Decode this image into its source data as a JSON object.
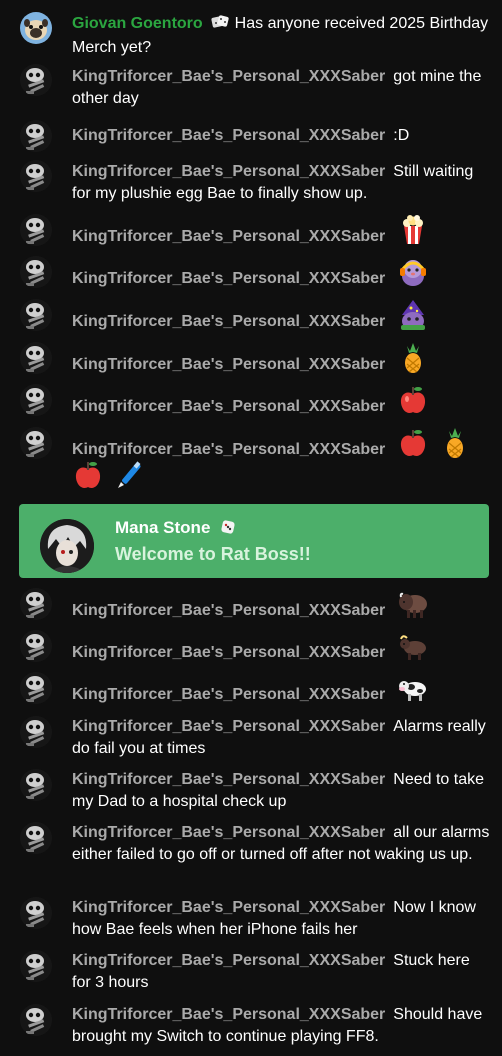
{
  "messages": [
    {
      "author": "Giovan Goentoro",
      "text": "Has anyone received 2025 Birthday Merch yet?",
      "author_color": "#2ba640",
      "avatar": "pug-avatar"
    },
    {
      "author": "KingTriforcer_Bae's_Personal_XXXSaber",
      "text": "got mine the other day"
    },
    {
      "author": "KingTriforcer_Bae's_Personal_XXXSaber",
      "text": ":D"
    },
    {
      "author": "KingTriforcer_Bae's_Personal_XXXSaber",
      "text": "Still waiting for my plushie egg Bae to finally show up."
    },
    {
      "author": "KingTriforcer_Bae's_Personal_XXXSaber",
      "emojis": [
        "popcorn-emoji"
      ]
    },
    {
      "author": "KingTriforcer_Bae's_Personal_XXXSaber",
      "emojis": [
        "rat-headphones-emoji"
      ]
    },
    {
      "author": "KingTriforcer_Bae's_Personal_XXXSaber",
      "emojis": [
        "rat-wizard-emoji"
      ]
    },
    {
      "author": "KingTriforcer_Bae's_Personal_XXXSaber",
      "emojis": [
        "pineapple-emoji"
      ]
    },
    {
      "author": "KingTriforcer_Bae's_Personal_XXXSaber",
      "emojis": [
        "apple-emoji"
      ]
    },
    {
      "author": "KingTriforcer_Bae's_Personal_XXXSaber",
      "emojis": [
        "apple-emoji",
        "pineapple-emoji",
        "apple-emoji",
        "pen-emoji"
      ]
    },
    {
      "author": "KingTriforcer_Bae's_Personal_XXXSaber",
      "emojis": [
        "bison-emoji"
      ]
    },
    {
      "author": "KingTriforcer_Bae's_Personal_XXXSaber",
      "emojis": [
        "ox-emoji"
      ]
    },
    {
      "author": "KingTriforcer_Bae's_Personal_XXXSaber",
      "emojis": [
        "cow-emoji"
      ]
    },
    {
      "author": "KingTriforcer_Bae's_Personal_XXXSaber",
      "text": "Alarms really do fail you at times"
    },
    {
      "author": "KingTriforcer_Bae's_Personal_XXXSaber",
      "text": "Need to take my Dad to a hospital check up"
    },
    {
      "author": "KingTriforcer_Bae's_Personal_XXXSaber",
      "text": "all our alarms either failed to go off or turned off after not waking us up."
    },
    {
      "author": "KingTriforcer_Bae's_Personal_XXXSaber",
      "text": "Now I know how Bae feels when her iPhone fails her"
    },
    {
      "author": "KingTriforcer_Bae's_Personal_XXXSaber",
      "text": "Stuck here for 3 hours"
    },
    {
      "author": "KingTriforcer_Bae's_Personal_XXXSaber",
      "text": "Should have brought my Switch to continue playing FF8."
    }
  ],
  "membership": {
    "author": "Mana Stone",
    "text": "Welcome to Rat Boss!!",
    "background": "#4caf6a"
  },
  "colors": {
    "background": "#0f0f0f",
    "author": "#aaaaaa",
    "message": "#ffffff",
    "owner_green": "#2ba640"
  }
}
